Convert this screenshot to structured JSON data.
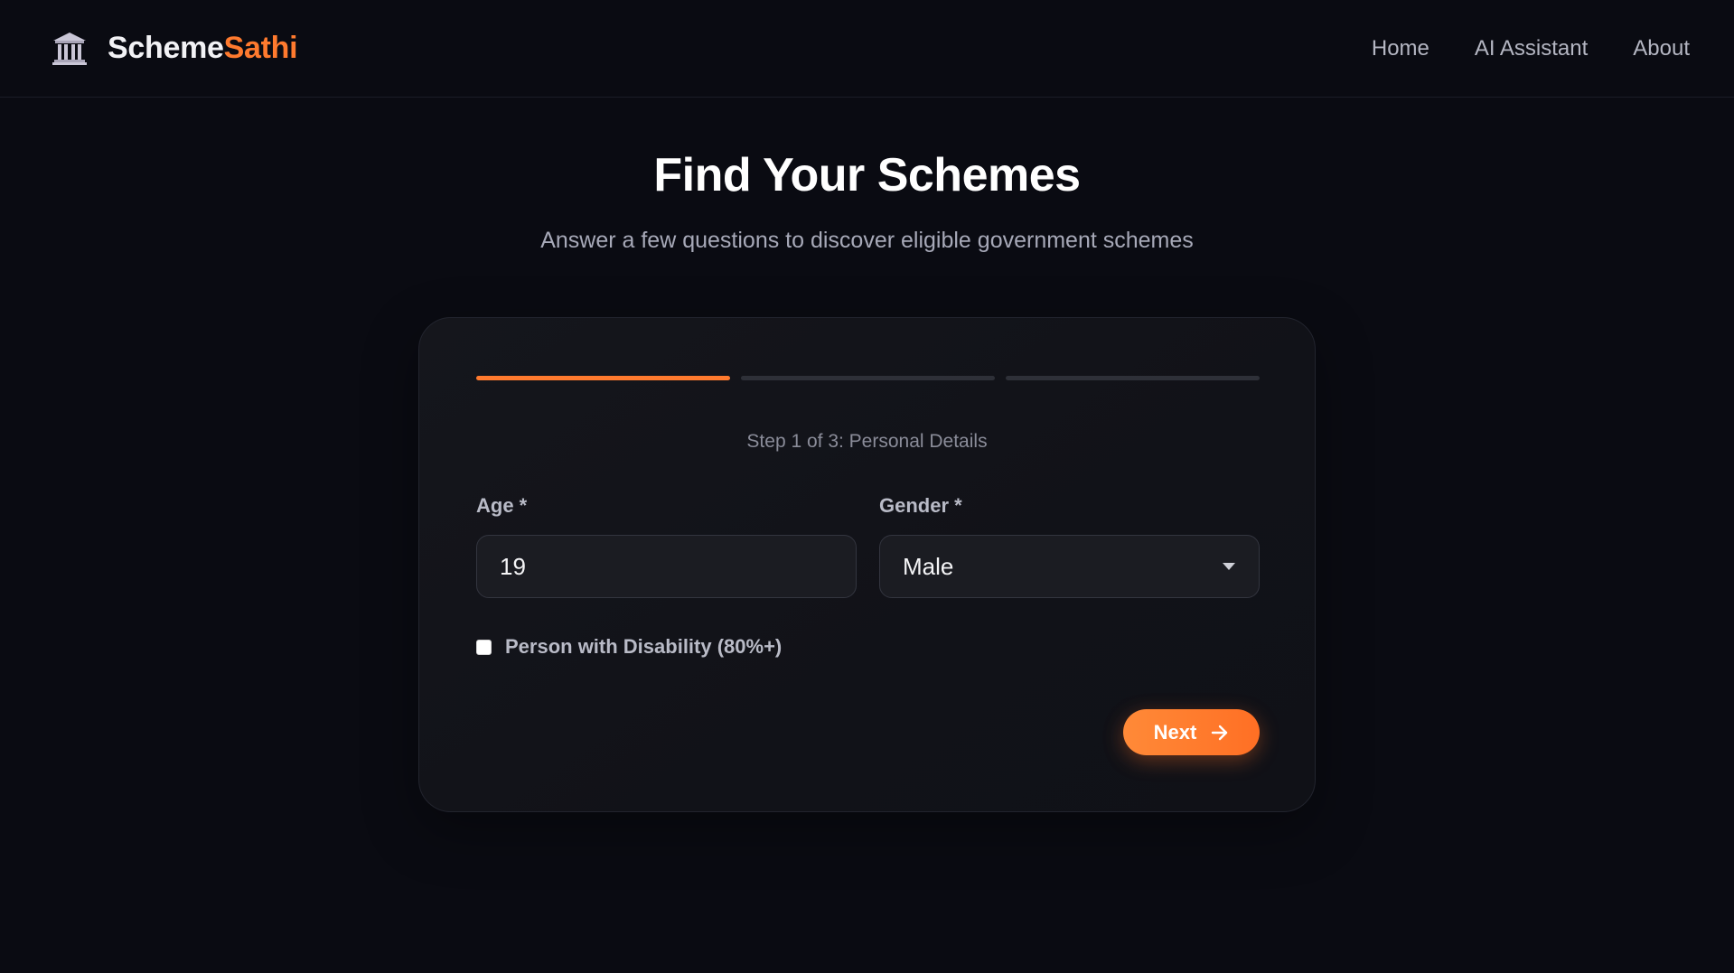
{
  "navbar": {
    "brand_icon": "government-building-icon",
    "brand_name_primary": "Scheme",
    "brand_name_accent": "Sathi",
    "links": [
      {
        "label": "Home"
      },
      {
        "label": "AI Assistant"
      },
      {
        "label": "About"
      }
    ]
  },
  "hero": {
    "title": "Find Your Schemes",
    "subtitle": "Answer a few questions to discover eligible government schemes"
  },
  "form": {
    "progress": {
      "total_steps": 3,
      "current_step": 1
    },
    "step_label": "Step 1 of 3: Personal Details",
    "age": {
      "label": "Age *",
      "value": "19"
    },
    "gender": {
      "label": "Gender *",
      "value": "Male",
      "icon": "chevron-down-icon"
    },
    "disability": {
      "label": "Person with Disability (80%+)",
      "checked": false
    },
    "next_button": {
      "label": "Next",
      "icon": "arrow-right-icon"
    }
  },
  "colors": {
    "background": "#0a0b12",
    "accent": "#ff7a2e",
    "card": "#13141a",
    "muted_text": "#a7a9b8"
  }
}
